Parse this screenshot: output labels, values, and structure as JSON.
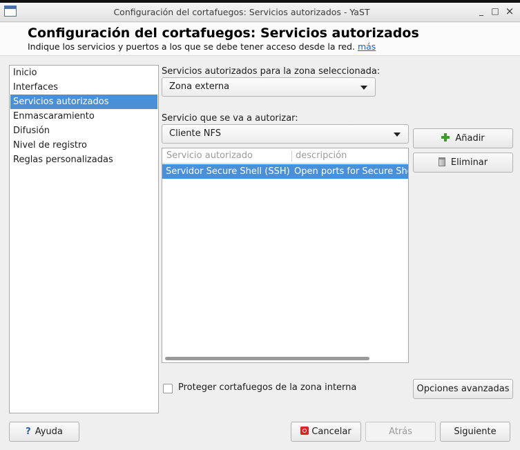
{
  "window": {
    "title": "Configuración del cortafuegos: Servicios autorizados - YaST",
    "minimize_glyph": "_",
    "maximize_glyph": "□",
    "close_glyph": "×"
  },
  "header": {
    "title": "Configuración del cortafuegos: Servicios autorizados",
    "subtitle": "Indique los servicios y puertos a los que se debe tener acceso desde la red.",
    "more_link": "más"
  },
  "sidebar": {
    "items": [
      {
        "label": "Inicio",
        "selected": false
      },
      {
        "label": "Interfaces",
        "selected": false
      },
      {
        "label": "Servicios autorizados",
        "selected": true
      },
      {
        "label": "Enmascaramiento",
        "selected": false
      },
      {
        "label": "Difusión",
        "selected": false
      },
      {
        "label": "Nivel de registro",
        "selected": false
      },
      {
        "label": "Reglas personalizadas",
        "selected": false
      }
    ]
  },
  "zone": {
    "label": "Servicios autorizados para la zona seleccionada:",
    "selected": "Zona externa"
  },
  "service": {
    "label": "Servicio que se va a autorizar:",
    "selected": "Cliente NFS"
  },
  "actions": {
    "add": "Añadir",
    "remove": "Eliminar",
    "advanced": "Opciones avanzadas"
  },
  "table": {
    "columns": [
      "Servicio autorizado",
      "descripción"
    ],
    "rows": [
      {
        "service": "Servidor Secure Shell (SSH)",
        "description": "Open ports for Secure Shell",
        "selected": true
      }
    ]
  },
  "protect_internal": {
    "label": "Proteger cortafuegos de la zona interna",
    "checked": false
  },
  "footer": {
    "help": "Ayuda",
    "cancel": "Cancelar",
    "back": "Atrás",
    "next": "Siguiente"
  },
  "colors": {
    "selection": "#4a90d9",
    "link": "#1e5fc7"
  }
}
